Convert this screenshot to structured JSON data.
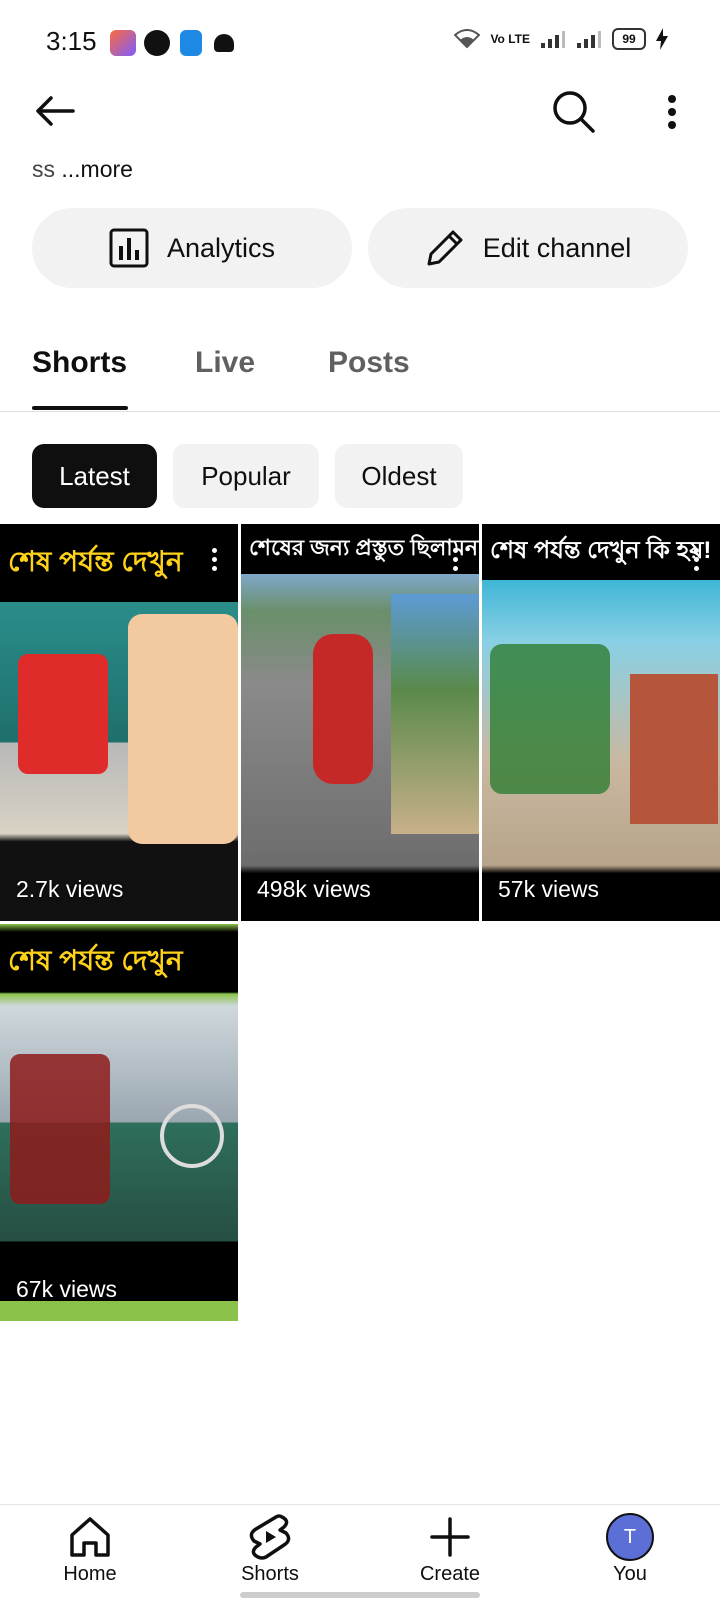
{
  "status_bar": {
    "time": "3:15",
    "battery": "99",
    "network": "Vo LTE"
  },
  "header": {
    "description_prefix": "ss",
    "description_more": "...more"
  },
  "actions": {
    "analytics_label": "Analytics",
    "edit_channel_label": "Edit channel"
  },
  "tabs": [
    {
      "label": "Shorts"
    },
    {
      "label": "Live"
    },
    {
      "label": "Posts"
    }
  ],
  "filters": [
    {
      "label": "Latest"
    },
    {
      "label": "Popular"
    },
    {
      "label": "Oldest"
    }
  ],
  "videos": [
    {
      "views": "2.7k views",
      "caption": "শেষ পর্যন্ত দেখুন"
    },
    {
      "views": "498k views",
      "caption": "শেষের জন্য প্রস্তুত ছিলামনা"
    },
    {
      "views": "57k views",
      "caption": "শেষ পর্যন্ত দেখুন কি হয়!"
    },
    {
      "views": "67k views",
      "caption": "শেষ পর্যন্ত দেখুন"
    }
  ],
  "bottom_nav": {
    "home": "Home",
    "shorts": "Shorts",
    "create": "Create",
    "you": "You",
    "avatar_letter": "T"
  },
  "colors": {
    "accent_dark": "#0f0f0f",
    "chip_bg": "#f2f2f2",
    "avatar": "#5b6fd6"
  }
}
